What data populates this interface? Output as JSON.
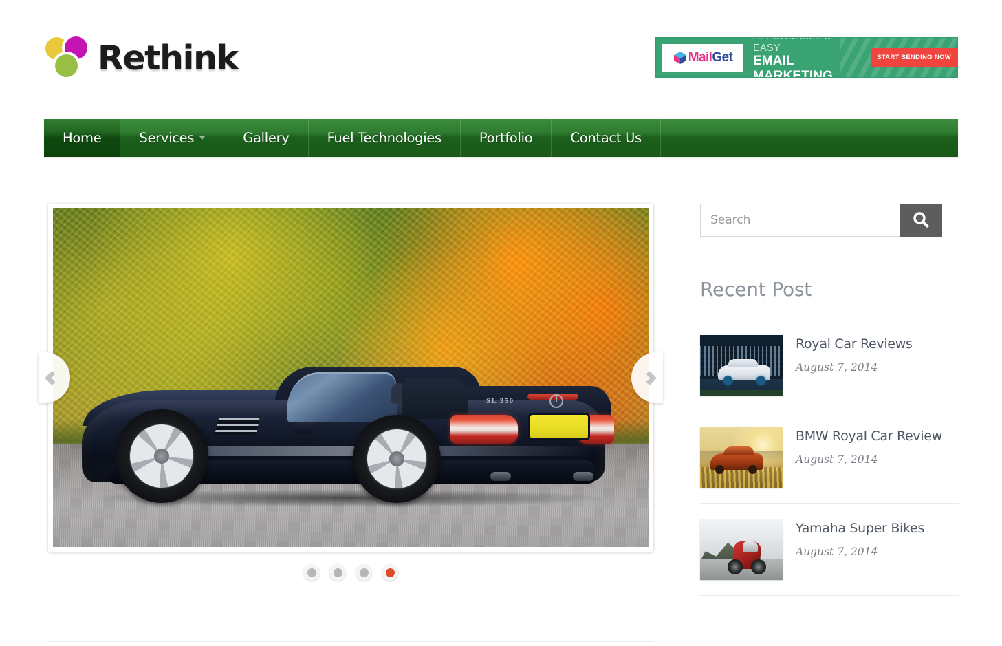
{
  "site": {
    "logo_text": "Rethink",
    "logo_colors": {
      "yellow": "#e8c93c",
      "magenta": "#c514b4",
      "green": "#97bf44"
    }
  },
  "banner_ad": {
    "logo_prefix": "Mail",
    "logo_suffix": "Get",
    "line_1": "AFFORDABLE & EASY",
    "line_2": "EMAIL MARKETING",
    "cta_label": "START SENDING NOW",
    "background_color": "#3aa374",
    "cta_color": "#f0453f"
  },
  "nav": {
    "items": [
      {
        "label": "Home",
        "active": true,
        "has_dropdown": false
      },
      {
        "label": "Services",
        "active": false,
        "has_dropdown": true
      },
      {
        "label": "Gallery",
        "active": false,
        "has_dropdown": false
      },
      {
        "label": "Fuel Technologies",
        "active": false,
        "has_dropdown": false
      },
      {
        "label": "Portfolio",
        "active": false,
        "has_dropdown": false
      },
      {
        "label": "Contact Us",
        "active": false,
        "has_dropdown": false
      }
    ],
    "background_color": "#1c5f1c",
    "active_color": "#0f4a0f"
  },
  "slider": {
    "prev_icon": "chevron-left-icon",
    "next_icon": "chevron-right-icon",
    "slide_alt": "Black Mercedes SL 350 convertible parked on a road with autumn foliage behind",
    "car_badge": "SL 350",
    "dots": [
      {
        "active": false
      },
      {
        "active": false
      },
      {
        "active": false
      },
      {
        "active": true
      }
    ],
    "active_dot_color": "#dd4b2b",
    "inactive_dot_color": "#b6b6b6"
  },
  "sidebar": {
    "search": {
      "placeholder": "Search",
      "value": "",
      "button_icon": "search-icon",
      "button_color": "#5d5d5d"
    },
    "recent_post_heading": "Recent Post",
    "posts": [
      {
        "title": "Royal Car Reviews",
        "date": "August 7, 2014",
        "thumb": "white-car-night-city-thumbnail"
      },
      {
        "title": "BMW Royal Car Review",
        "date": "August 7, 2014",
        "thumb": "orange-bmw-sunset-thumbnail"
      },
      {
        "title": "Yamaha Super Bikes",
        "date": "August 7, 2014",
        "thumb": "red-motorcycle-mountain-thumbnail"
      }
    ]
  }
}
